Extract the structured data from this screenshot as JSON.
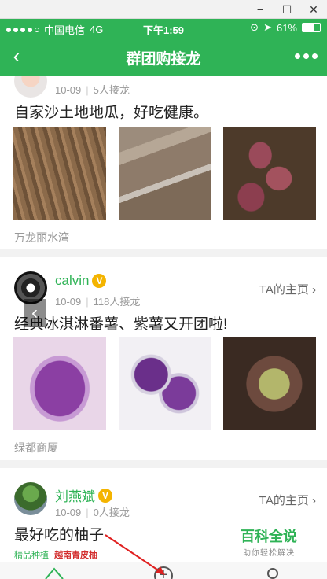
{
  "window": {
    "minimize": "−",
    "maximize": "☐",
    "close": "✕"
  },
  "status_bar": {
    "carrier": "中国电信",
    "network": "4G",
    "time": "下午1:59",
    "battery": "61%"
  },
  "nav": {
    "back_icon": "chevron-left-icon",
    "title": "群团购接龙",
    "more_icon": "more-dots-icon"
  },
  "posts": [
    {
      "date": "10-09",
      "participants": "5人接龙",
      "text": "自家沙土地地瓜，好吃健康。",
      "location": "万龙丽水湾"
    },
    {
      "username": "calvin",
      "verified": "V",
      "date": "10-09",
      "participants": "118人接龙",
      "home_link": "TA的主页 ›",
      "text": "经典冰淇淋番薯、紫薯又开团啦!",
      "location": "绿都商厦"
    },
    {
      "username": "刘燕斌",
      "verified": "V",
      "date": "10-09",
      "participants": "0人接龙",
      "home_link": "TA的主页 ›",
      "text": "最好吃的柚子",
      "ad_text_1": "精品种植",
      "ad_text_2": "越南青皮柚"
    }
  ],
  "tabbar": {
    "add_icon": "+",
    "home_icon": "home-icon",
    "me_icon": "user-icon"
  },
  "watermark": {
    "title": "百科全说",
    "subtitle": "助你轻松解决"
  },
  "colors": {
    "brand_green": "#2fb356",
    "badge_gold": "#f4b400"
  }
}
